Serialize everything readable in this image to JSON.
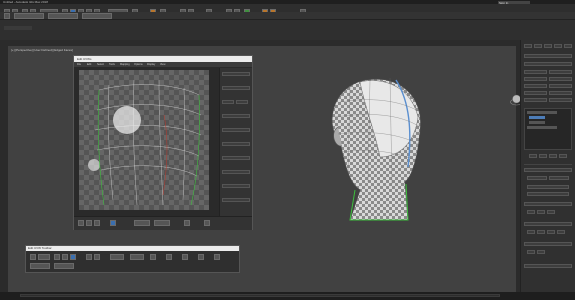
{
  "window": {
    "title": "Untitled - Autodesk 3ds Max 2018",
    "sign_in": "Sign In"
  },
  "viewport": {
    "label": "[+] [Perspective] [User Defined] [Edged Faces]"
  },
  "uv_editor": {
    "title": "Edit UVWs",
    "menu": [
      "File",
      "Edit",
      "Select",
      "Tools",
      "Mapping",
      "Options",
      "Display",
      "View"
    ]
  },
  "dock_toolbar": {
    "title": "Edit UVW Toolbar"
  },
  "icons": {
    "gizmo": "viewcube-icon",
    "skull": "head-model"
  },
  "colors": {
    "accent": "#4d7db8",
    "seam": "#3cbf3c",
    "viewport_bg": "#414141"
  }
}
